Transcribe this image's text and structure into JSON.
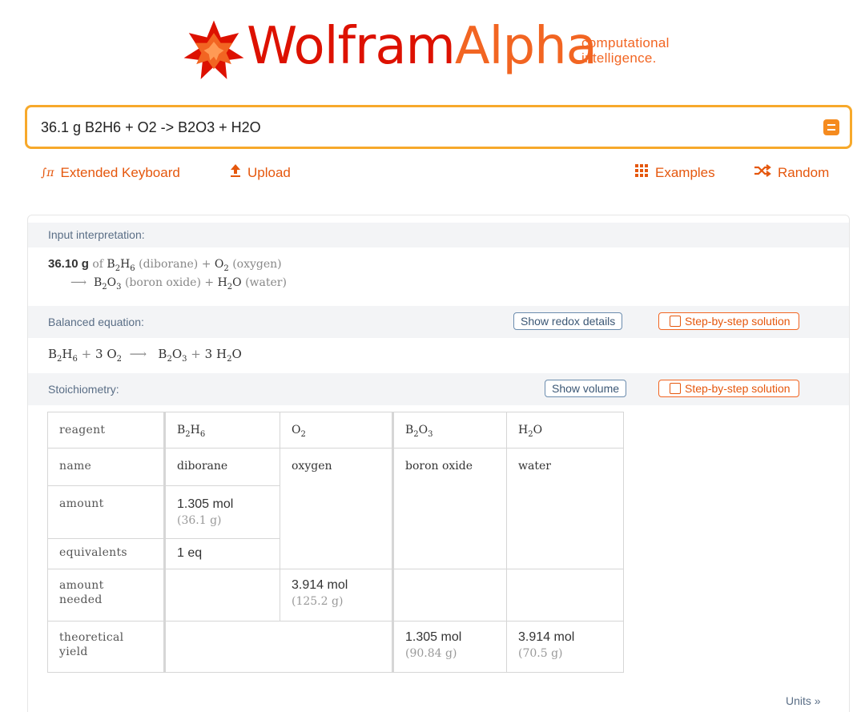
{
  "header": {
    "logo_word_1": "Wolfram",
    "logo_word_2": "Alpha",
    "tagline_1": "computational",
    "tagline_2": "intelligence.",
    "star_icon": "wolfram-spikey-icon",
    "colors": {
      "red": "#dd1100",
      "orange": "#f26522",
      "search_border": "#f7a92b"
    }
  },
  "search": {
    "value": "36.1 g B2H6 + O2 -> B2O3 + H2O",
    "submit_icon": "equals-icon"
  },
  "toolbar": {
    "extended_keyboard": "Extended Keyboard",
    "upload": "Upload",
    "examples": "Examples",
    "random": "Random"
  },
  "pods": {
    "input": {
      "title": "Input interpretation:",
      "line1": {
        "mass": "36.10 g",
        "of": "of",
        "r1_name": "(diborane)",
        "plus": "+",
        "r2_name": "(oxygen)"
      },
      "line2": {
        "arrow": "⟶",
        "p1_name": "(boron oxide)",
        "plus": "+",
        "p2_name": "(water)"
      }
    },
    "balanced": {
      "title": "Balanced equation:",
      "show_button": "Show redox details",
      "step_button": "Step-by-step solution",
      "coef_o2": "3",
      "coef_h2o": "3",
      "plus": "+",
      "arrow": "⟶"
    },
    "stoich": {
      "title": "Stoichiometry:",
      "show_button": "Show volume",
      "step_button": "Step-by-step solution",
      "row_labels": {
        "reagent": "reagent",
        "name": "name",
        "amount": "amount",
        "equivalents": "equivalents",
        "amount_needed_1": "amount",
        "amount_needed_2": "needed",
        "yield_1": "theoretical",
        "yield_2": "yield"
      },
      "names": {
        "b2h6": "diborane",
        "o2": "oxygen",
        "b2o3": "boron oxide",
        "h2o": "water"
      },
      "b2h6_amount": "1.305 mol",
      "b2h6_mass": "(36.1 g)",
      "b2h6_equivalents": "1 eq",
      "o2_needed": "3.914 mol",
      "o2_needed_mass": "(125.2 g)",
      "b2o3_yield": "1.305 mol",
      "b2o3_yield_mass": "(90.84 g)",
      "h2o_yield": "3.914 mol",
      "h2o_yield_mass": "(70.5 g)",
      "units_link": "Units »"
    }
  }
}
